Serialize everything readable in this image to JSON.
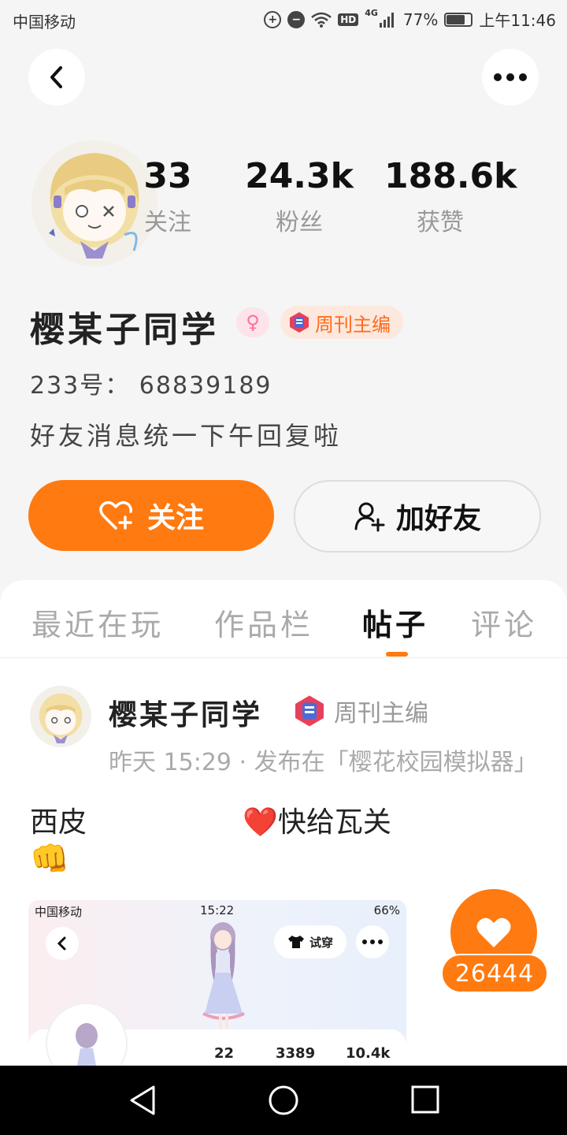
{
  "status_bar": {
    "carrier": "中国移动",
    "network": "4G",
    "hd": "HD",
    "battery": "77%",
    "time": "上午11:46"
  },
  "profile": {
    "stats": [
      {
        "value": "33",
        "label": "关注"
      },
      {
        "value": "24.3k",
        "label": "粉丝"
      },
      {
        "value": "188.6k",
        "label": "获赞"
      }
    ],
    "name": "樱某子同学",
    "gender_icon": "female-icon",
    "title_badge": "周刊主编",
    "uid": "233号： 68839189",
    "bio": "好友消息统一下午回复啦"
  },
  "actions": {
    "follow": "关注",
    "add_friend": "加好友"
  },
  "tabs": [
    {
      "label": "最近在玩",
      "active": false
    },
    {
      "label": "作品栏",
      "active": false
    },
    {
      "label": "帖子",
      "active": true
    },
    {
      "label": "评论",
      "active": false
    }
  ],
  "post": {
    "author": "樱某子同学",
    "badge": "周刊主编",
    "meta": "昨天 15:29 · 发布在「樱花校园模拟器」",
    "text_1": "西皮",
    "text_2": "❤️快给瓦关",
    "emoji": "👊",
    "image": {
      "status_carrier": "中国移动",
      "status_time": "15:22",
      "status_battery": "66%",
      "try_on": "试穿",
      "stats": [
        "22",
        "3389",
        "10.4k"
      ]
    },
    "likes": "26444"
  },
  "colors": {
    "accent": "#ff7a10",
    "badge_bg": "#fde8de",
    "gender_pink": "#ff6f9a"
  }
}
